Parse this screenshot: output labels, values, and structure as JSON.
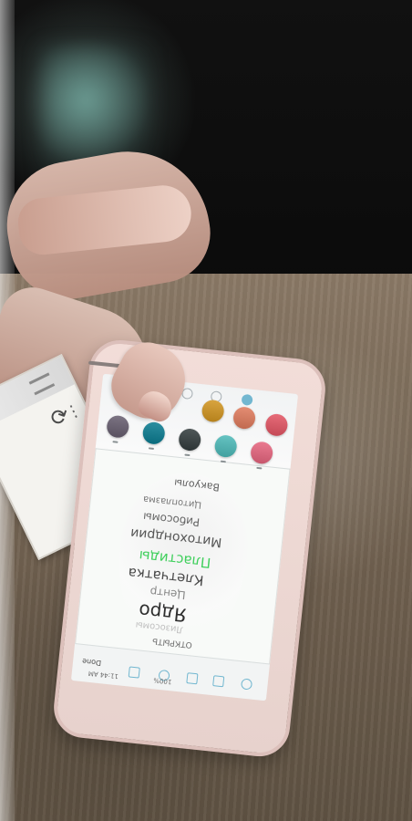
{
  "scene": {
    "type": "photo",
    "subject": "hand-holding-phone"
  },
  "paper_card": {
    "reload_icon": "reload-icon",
    "more_icon": "more-icon",
    "bars_icon": "signal-bars-icon"
  },
  "phone": {
    "colors": {
      "body": "#efd9d4",
      "screen": "#f8faf8",
      "accent_blue": "#72b7d0"
    },
    "palette": {
      "swatches": [
        {
          "name": "gradient-1",
          "color": "#7c7483"
        },
        {
          "name": "gradient-2",
          "color": "#2c8ea0"
        },
        {
          "name": "gradient-3",
          "color": "#4f5758"
        },
        {
          "name": "gradient-4",
          "color": "#d8a43f"
        },
        {
          "name": "gradient-5",
          "color": "#e48d73"
        },
        {
          "name": "gradient-6",
          "color": "#65c3c2"
        },
        {
          "name": "gradient-7",
          "color": "#ea7a90"
        },
        {
          "name": "gradient-8",
          "color": "#e76c79"
        }
      ]
    },
    "word_cloud": {
      "words": [
        {
          "text": "Вакуолы",
          "color": "#5f5f5f"
        },
        {
          "text": "Цитоплазма",
          "color": "#777777"
        },
        {
          "text": "Рибосомы",
          "color": "#666666"
        },
        {
          "text": "Митохондрии",
          "color": "#555555"
        },
        {
          "text": "Пластиды",
          "color": "#3fcf5c"
        },
        {
          "text": "Клетчатка",
          "color": "#4a4a4a"
        },
        {
          "text": "Центр",
          "color": "#888888"
        },
        {
          "text": "Ядро",
          "color": "#2f2f2f"
        },
        {
          "text": "Лизосомы",
          "color": "#bfbfbf"
        },
        {
          "text": "ОТКРЫТЬ",
          "color": "#6f6f6f"
        }
      ]
    },
    "bottom_bar": {
      "left_label": "Done",
      "status_left": "11:44 AM",
      "status_center": "100%"
    }
  }
}
